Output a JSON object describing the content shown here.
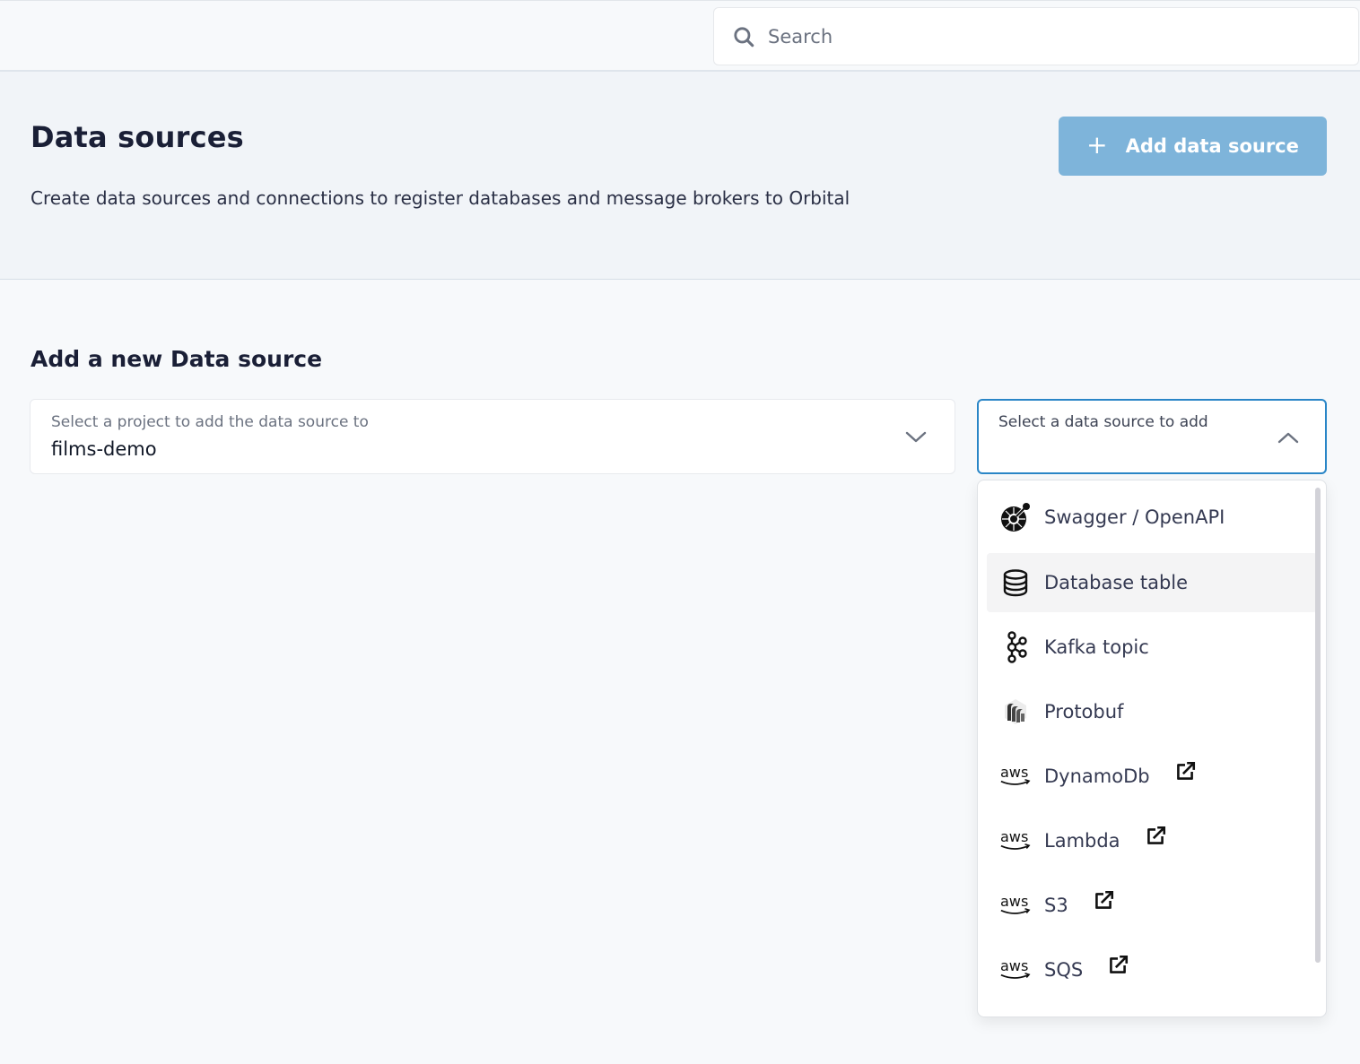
{
  "topbar": {
    "search": {
      "placeholder": "Search",
      "icon": "search-icon"
    }
  },
  "header": {
    "title": "Data sources",
    "description": "Create data sources and connections to register databases and message brokers to Orbital",
    "add_button": {
      "icon": "plus-icon",
      "plus": "+",
      "label": "Add data source"
    }
  },
  "form": {
    "section_title": "Add a new Data source",
    "project_select": {
      "label": "Select a project to add the data source to",
      "value": "films-demo",
      "state": "collapsed"
    },
    "source_select": {
      "label": "Select a data source to add",
      "value": "",
      "state": "expanded"
    }
  },
  "dropdown": {
    "options": [
      {
        "label": "Swagger / OpenAPI",
        "icon": "swagger-icon",
        "external": false,
        "highlighted": false
      },
      {
        "label": "Database table",
        "icon": "database-icon",
        "external": false,
        "highlighted": true
      },
      {
        "label": "Kafka topic",
        "icon": "kafka-icon",
        "external": false,
        "highlighted": false
      },
      {
        "label": "Protobuf",
        "icon": "protobuf-icon",
        "external": false,
        "highlighted": false
      },
      {
        "label": "DynamoDb",
        "icon": "aws-icon",
        "external": true,
        "highlighted": false
      },
      {
        "label": "Lambda",
        "icon": "aws-icon",
        "external": true,
        "highlighted": false
      },
      {
        "label": "S3",
        "icon": "aws-icon",
        "external": true,
        "highlighted": false
      },
      {
        "label": "SQS",
        "icon": "aws-icon",
        "external": true,
        "highlighted": false
      }
    ]
  },
  "colors": {
    "accent": "#2a86c7",
    "button_bg": "#7eb4da",
    "header_bg": "#f1f4f8",
    "page_bg": "#f7f9fb",
    "title_text": "#1a1f36"
  }
}
